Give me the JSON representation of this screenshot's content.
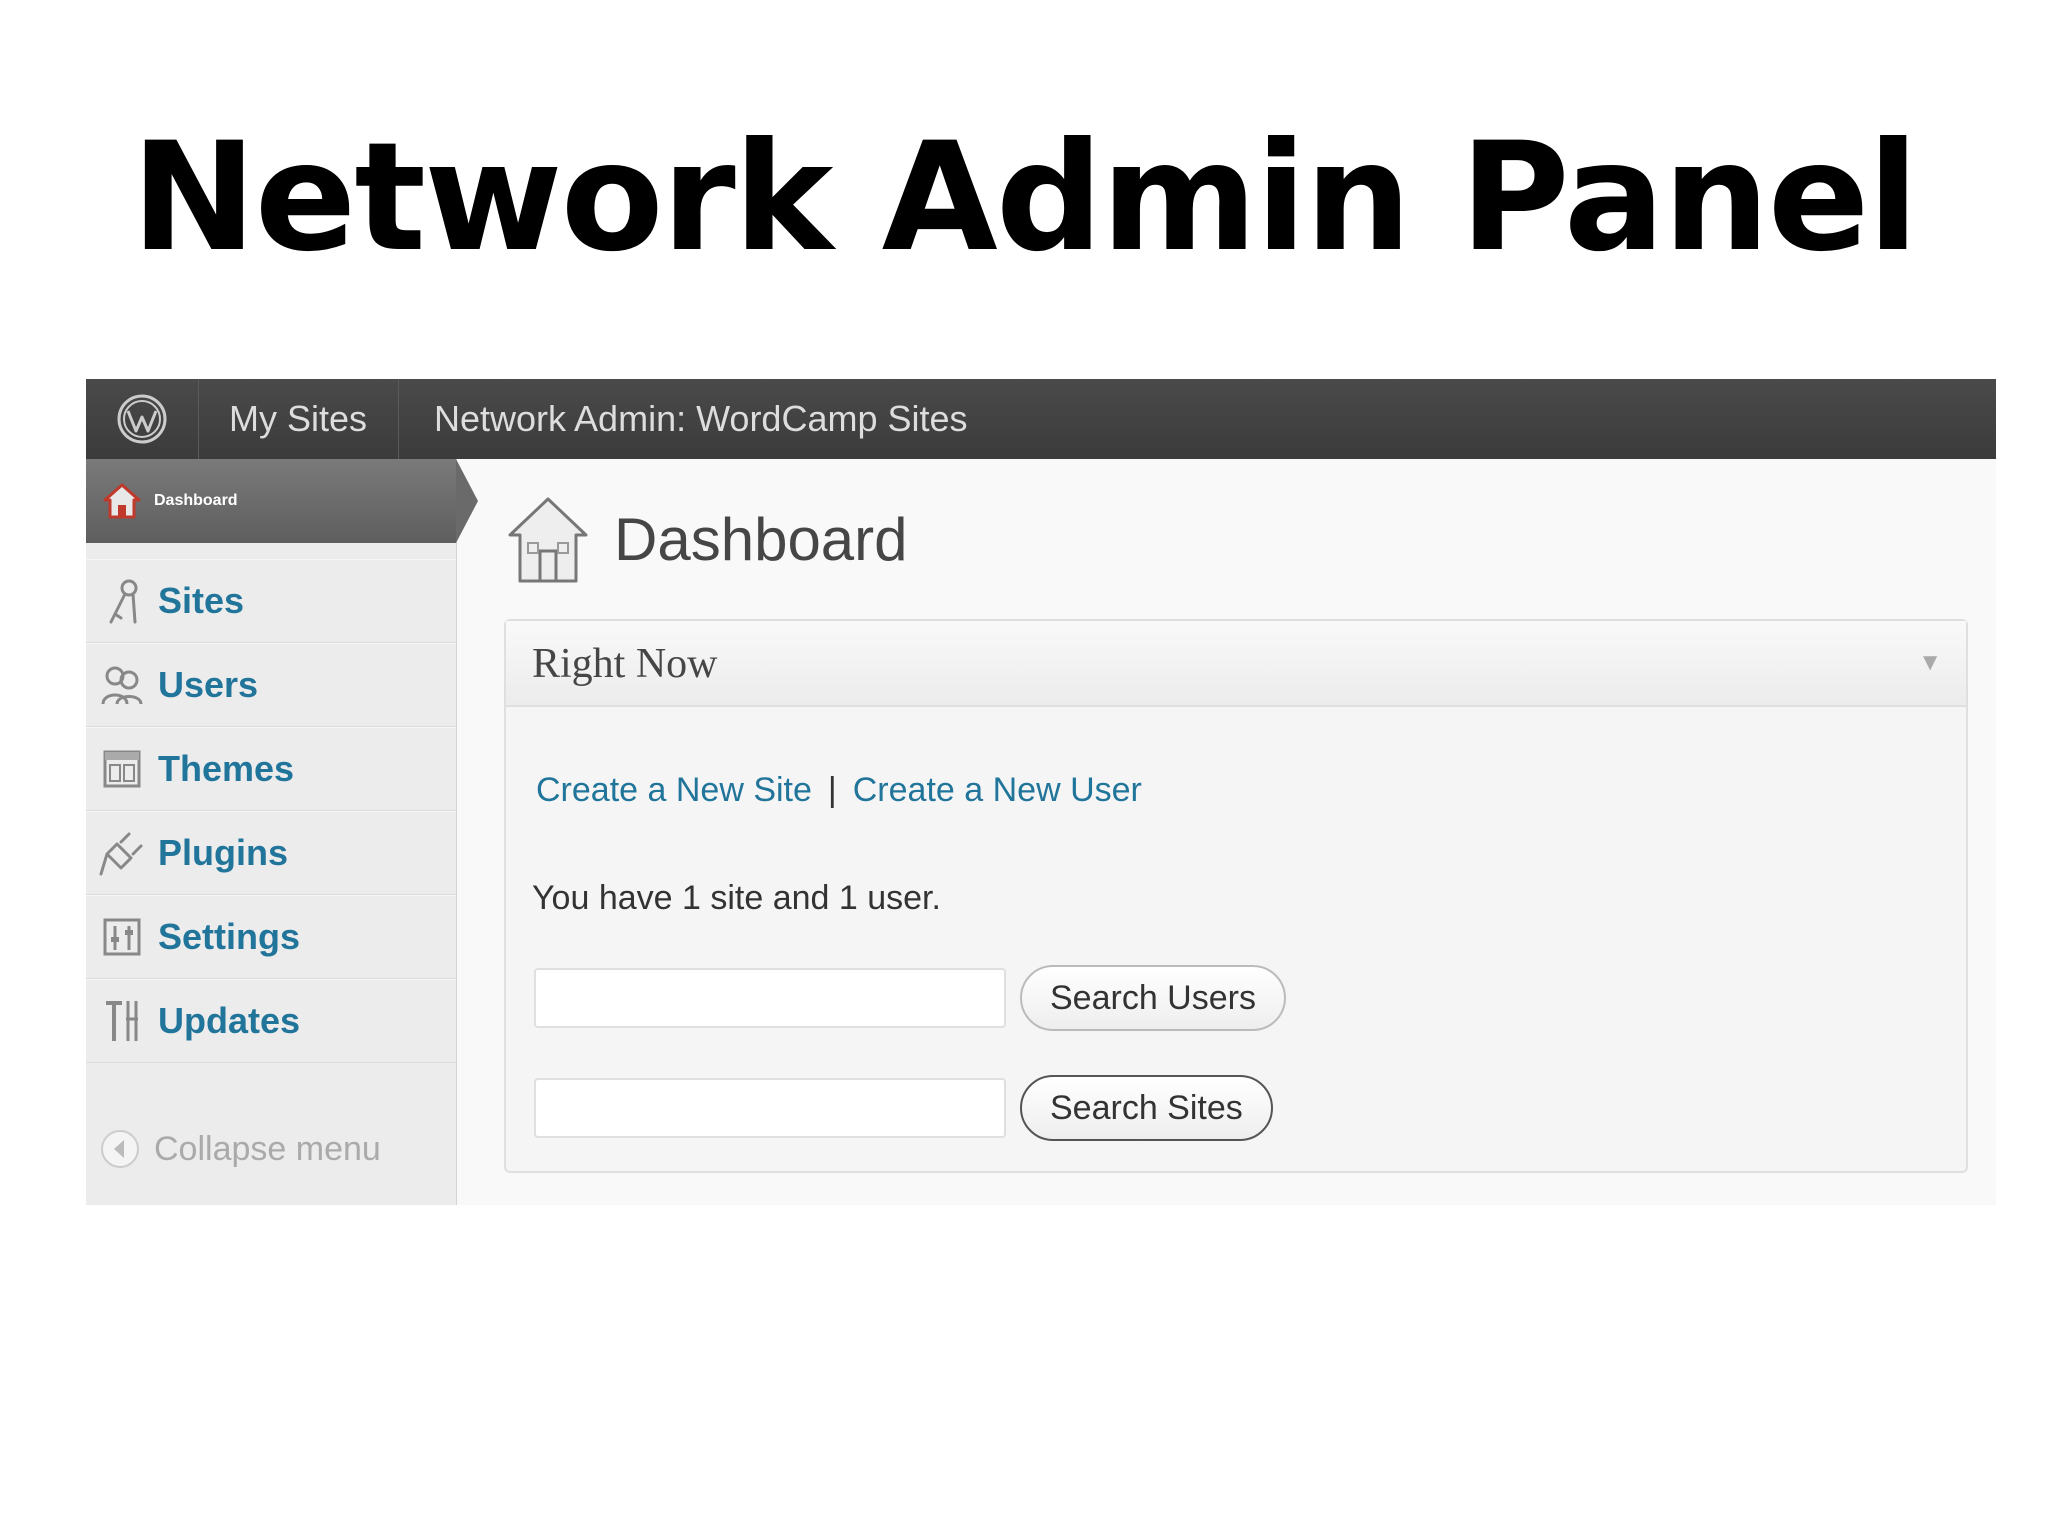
{
  "slide": {
    "title": "Network Admin Panel"
  },
  "admin_bar": {
    "logo_icon": "wordpress-logo-icon",
    "my_sites": "My Sites",
    "network_admin": "Network Admin: WordCamp Sites"
  },
  "sidebar": {
    "current": {
      "label": "Dashboard",
      "icon": "home-icon"
    },
    "items": [
      {
        "label": "Sites",
        "icon": "sites-icon"
      },
      {
        "label": "Users",
        "icon": "users-icon"
      },
      {
        "label": "Themes",
        "icon": "themes-icon"
      },
      {
        "label": "Plugins",
        "icon": "plugins-icon"
      },
      {
        "label": "Settings",
        "icon": "settings-icon"
      },
      {
        "label": "Updates",
        "icon": "updates-icon"
      }
    ],
    "collapse_label": "Collapse menu"
  },
  "main": {
    "page_title": "Dashboard",
    "widget": {
      "title": "Right Now",
      "link_new_site": "Create a New Site",
      "separator": "|",
      "link_new_user": "Create a New User",
      "summary": "You have 1 site and 1 user.",
      "search_users_value": "",
      "search_users_button": "Search Users",
      "search_sites_value": "",
      "search_sites_button": "Search Sites"
    }
  },
  "colors": {
    "admin_bar": "#464646",
    "link": "#21759b",
    "sidebar_bg": "#ececec",
    "current_menu": "#6a6a6a"
  }
}
